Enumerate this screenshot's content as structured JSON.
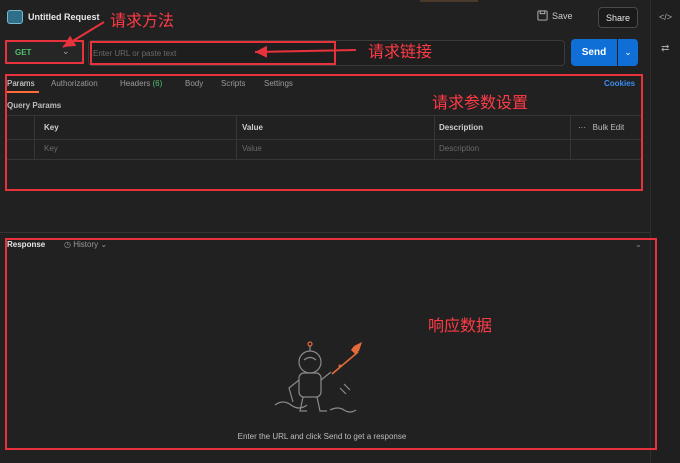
{
  "header": {
    "title": "Untitled Request",
    "save_label": "Save",
    "share_label": "Share"
  },
  "request": {
    "method": "GET",
    "url_placeholder": "Enter URL or paste text",
    "send_label": "Send"
  },
  "tabs": [
    {
      "label": "Params",
      "active": true
    },
    {
      "label": "Authorization"
    },
    {
      "label": "Headers",
      "count": "(6)"
    },
    {
      "label": "Body"
    },
    {
      "label": "Scripts"
    },
    {
      "label": "Settings"
    }
  ],
  "cookies_label": "Cookies",
  "query_params": {
    "title": "Query Params",
    "columns": [
      "Key",
      "Value",
      "Description"
    ],
    "bulk_edit": "Bulk Edit",
    "placeholders": [
      "Key",
      "Value",
      "Description"
    ]
  },
  "response": {
    "label": "Response",
    "history_label": "History",
    "empty_message": "Enter the URL and click Send to get a response"
  },
  "annotations": {
    "method": "请求方法",
    "url": "请求链接",
    "params": "请求参数设置",
    "response": "响应数据"
  },
  "colors": {
    "accent": "#0f6fd6",
    "method_get": "#52c06e",
    "annotation": "#e8323c",
    "tab_underline": "#ff6c37"
  }
}
